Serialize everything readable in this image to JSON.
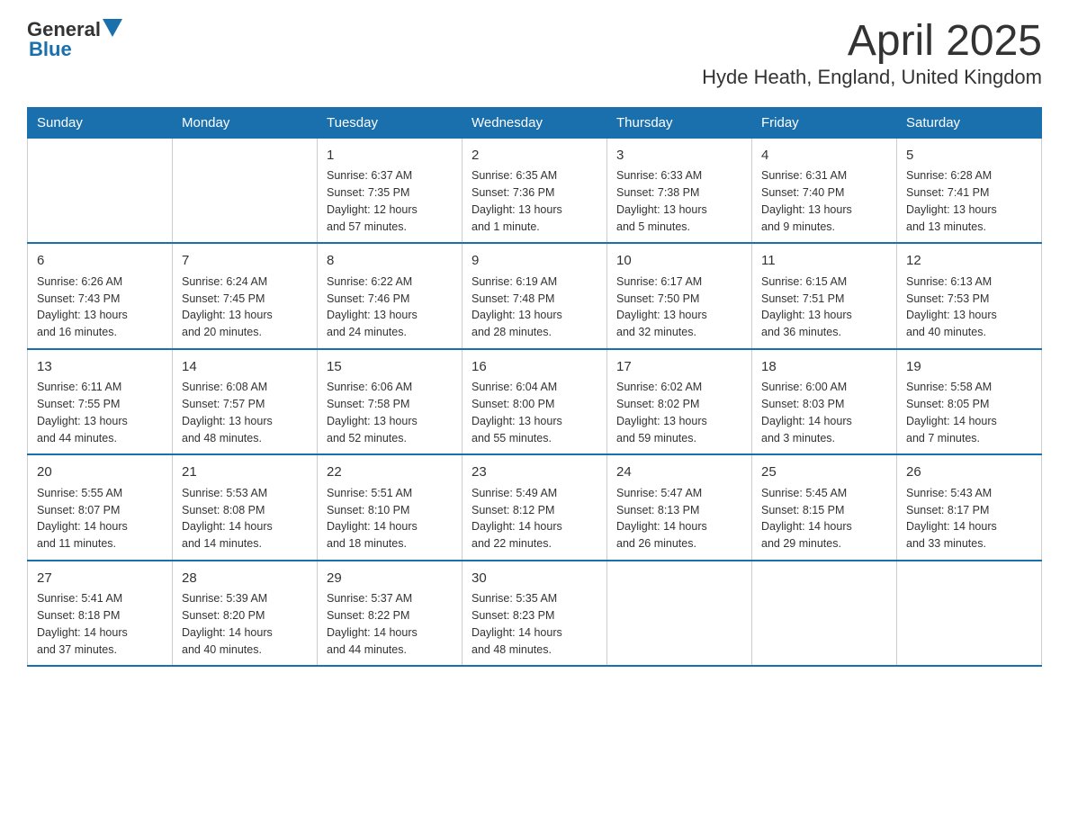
{
  "header": {
    "logo_general": "General",
    "logo_blue": "Blue",
    "title": "April 2025",
    "subtitle": "Hyde Heath, England, United Kingdom"
  },
  "weekdays": [
    "Sunday",
    "Monday",
    "Tuesday",
    "Wednesday",
    "Thursday",
    "Friday",
    "Saturday"
  ],
  "weeks": [
    [
      {
        "num": "",
        "info": ""
      },
      {
        "num": "",
        "info": ""
      },
      {
        "num": "1",
        "info": "Sunrise: 6:37 AM\nSunset: 7:35 PM\nDaylight: 12 hours\nand 57 minutes."
      },
      {
        "num": "2",
        "info": "Sunrise: 6:35 AM\nSunset: 7:36 PM\nDaylight: 13 hours\nand 1 minute."
      },
      {
        "num": "3",
        "info": "Sunrise: 6:33 AM\nSunset: 7:38 PM\nDaylight: 13 hours\nand 5 minutes."
      },
      {
        "num": "4",
        "info": "Sunrise: 6:31 AM\nSunset: 7:40 PM\nDaylight: 13 hours\nand 9 minutes."
      },
      {
        "num": "5",
        "info": "Sunrise: 6:28 AM\nSunset: 7:41 PM\nDaylight: 13 hours\nand 13 minutes."
      }
    ],
    [
      {
        "num": "6",
        "info": "Sunrise: 6:26 AM\nSunset: 7:43 PM\nDaylight: 13 hours\nand 16 minutes."
      },
      {
        "num": "7",
        "info": "Sunrise: 6:24 AM\nSunset: 7:45 PM\nDaylight: 13 hours\nand 20 minutes."
      },
      {
        "num": "8",
        "info": "Sunrise: 6:22 AM\nSunset: 7:46 PM\nDaylight: 13 hours\nand 24 minutes."
      },
      {
        "num": "9",
        "info": "Sunrise: 6:19 AM\nSunset: 7:48 PM\nDaylight: 13 hours\nand 28 minutes."
      },
      {
        "num": "10",
        "info": "Sunrise: 6:17 AM\nSunset: 7:50 PM\nDaylight: 13 hours\nand 32 minutes."
      },
      {
        "num": "11",
        "info": "Sunrise: 6:15 AM\nSunset: 7:51 PM\nDaylight: 13 hours\nand 36 minutes."
      },
      {
        "num": "12",
        "info": "Sunrise: 6:13 AM\nSunset: 7:53 PM\nDaylight: 13 hours\nand 40 minutes."
      }
    ],
    [
      {
        "num": "13",
        "info": "Sunrise: 6:11 AM\nSunset: 7:55 PM\nDaylight: 13 hours\nand 44 minutes."
      },
      {
        "num": "14",
        "info": "Sunrise: 6:08 AM\nSunset: 7:57 PM\nDaylight: 13 hours\nand 48 minutes."
      },
      {
        "num": "15",
        "info": "Sunrise: 6:06 AM\nSunset: 7:58 PM\nDaylight: 13 hours\nand 52 minutes."
      },
      {
        "num": "16",
        "info": "Sunrise: 6:04 AM\nSunset: 8:00 PM\nDaylight: 13 hours\nand 55 minutes."
      },
      {
        "num": "17",
        "info": "Sunrise: 6:02 AM\nSunset: 8:02 PM\nDaylight: 13 hours\nand 59 minutes."
      },
      {
        "num": "18",
        "info": "Sunrise: 6:00 AM\nSunset: 8:03 PM\nDaylight: 14 hours\nand 3 minutes."
      },
      {
        "num": "19",
        "info": "Sunrise: 5:58 AM\nSunset: 8:05 PM\nDaylight: 14 hours\nand 7 minutes."
      }
    ],
    [
      {
        "num": "20",
        "info": "Sunrise: 5:55 AM\nSunset: 8:07 PM\nDaylight: 14 hours\nand 11 minutes."
      },
      {
        "num": "21",
        "info": "Sunrise: 5:53 AM\nSunset: 8:08 PM\nDaylight: 14 hours\nand 14 minutes."
      },
      {
        "num": "22",
        "info": "Sunrise: 5:51 AM\nSunset: 8:10 PM\nDaylight: 14 hours\nand 18 minutes."
      },
      {
        "num": "23",
        "info": "Sunrise: 5:49 AM\nSunset: 8:12 PM\nDaylight: 14 hours\nand 22 minutes."
      },
      {
        "num": "24",
        "info": "Sunrise: 5:47 AM\nSunset: 8:13 PM\nDaylight: 14 hours\nand 26 minutes."
      },
      {
        "num": "25",
        "info": "Sunrise: 5:45 AM\nSunset: 8:15 PM\nDaylight: 14 hours\nand 29 minutes."
      },
      {
        "num": "26",
        "info": "Sunrise: 5:43 AM\nSunset: 8:17 PM\nDaylight: 14 hours\nand 33 minutes."
      }
    ],
    [
      {
        "num": "27",
        "info": "Sunrise: 5:41 AM\nSunset: 8:18 PM\nDaylight: 14 hours\nand 37 minutes."
      },
      {
        "num": "28",
        "info": "Sunrise: 5:39 AM\nSunset: 8:20 PM\nDaylight: 14 hours\nand 40 minutes."
      },
      {
        "num": "29",
        "info": "Sunrise: 5:37 AM\nSunset: 8:22 PM\nDaylight: 14 hours\nand 44 minutes."
      },
      {
        "num": "30",
        "info": "Sunrise: 5:35 AM\nSunset: 8:23 PM\nDaylight: 14 hours\nand 48 minutes."
      },
      {
        "num": "",
        "info": ""
      },
      {
        "num": "",
        "info": ""
      },
      {
        "num": "",
        "info": ""
      }
    ]
  ]
}
